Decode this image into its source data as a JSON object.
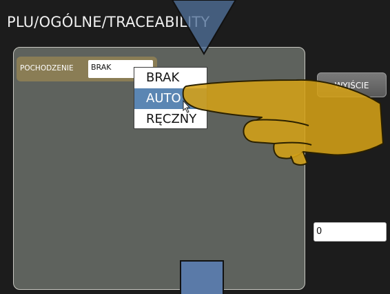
{
  "window": {
    "title": "PLU/OGÓLNE/TRACEABILITY"
  },
  "form": {
    "origin_label": "POCHODZENIE",
    "origin_value": "BRAK"
  },
  "dropdown": {
    "options": [
      "BRAK",
      "AUTO",
      "RĘCZNY"
    ],
    "selected": "AUTO"
  },
  "sidebar": {
    "exit_label": "WYJŚCIE",
    "number_value": "0"
  },
  "icons": {
    "arrow_top": "arrow-down-icon",
    "arrow_bottom": "arrow-up-icon",
    "pointer": "pointing-hand-icon",
    "cursor": "mouse-cursor-icon"
  },
  "colors": {
    "panel": "#5e625d",
    "field_group": "#8a7d55",
    "selection": "#5b86b3",
    "hand": "#d4a017",
    "arrow": "#4f6f99"
  }
}
